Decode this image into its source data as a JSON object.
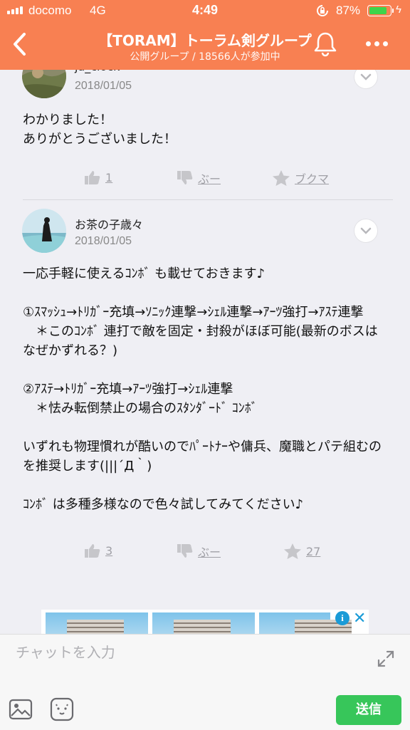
{
  "status_bar": {
    "carrier": "docomo",
    "network": "4G",
    "time": "4:49",
    "battery_percent": "87%",
    "battery_level": 0.87
  },
  "header": {
    "title": "【TORAM】トーラム剣グループ",
    "subtitle": "公開グループ / 18566人が参加中"
  },
  "posts": [
    {
      "user": "ja_clock",
      "date": "2018/01/05",
      "body": "わかりました！\nありがとうございました！",
      "likes": "1",
      "dislike_label": "ぶー",
      "bookmark_label": "ブクマ"
    },
    {
      "user": "お茶の子歳々",
      "date": "2018/01/05",
      "body": "一応手軽に使えるｺﾝﾎﾞ も載せておきます♪\n\n①ｽﾏｯｼｭ→ﾄﾘｶﾞｰ充填→ｿﾆｯｸ連撃→ｼｪﾙ連撃→ｱｰﾂ強打→ｱｽﾃ連撃\n　＊このｺﾝﾎﾞ 連打で敵を固定・封殺がほぼ可能(最新のボスはなぜかずれる？)\n\n②ｱｽﾃ→ﾄﾘｶﾞｰ充填→ｱｰﾂ強打→ｼｪﾙ連撃\n　＊怯み転倒禁止の場合のｽﾀﾝﾀﾞｰﾄﾞ ｺﾝﾎﾞ\n\nいずれも物理慣れが酷いのでﾊﾟｰﾄﾅｰや傭兵、魔職とパテ組むのを推奨します(|||´Д｀)\n\nｺﾝﾎﾞ は多種多様なので色々試してみてください♪",
      "likes": "3",
      "dislike_label": "ぶー",
      "bookmark_count": "27"
    }
  ],
  "composer": {
    "placeholder": "チャットを入力",
    "send_label": "送信"
  },
  "icons": [
    "back-chevron-icon",
    "bell-icon",
    "more-icon",
    "chevron-down-icon",
    "thumbs-up-icon",
    "thumbs-down-icon",
    "star-icon",
    "expand-icon",
    "image-icon",
    "stamp-icon",
    "ad-info-icon",
    "ad-close-icon"
  ],
  "colors": {
    "accent": "#f88052",
    "send": "#37c65a",
    "background": "#efeff4"
  }
}
